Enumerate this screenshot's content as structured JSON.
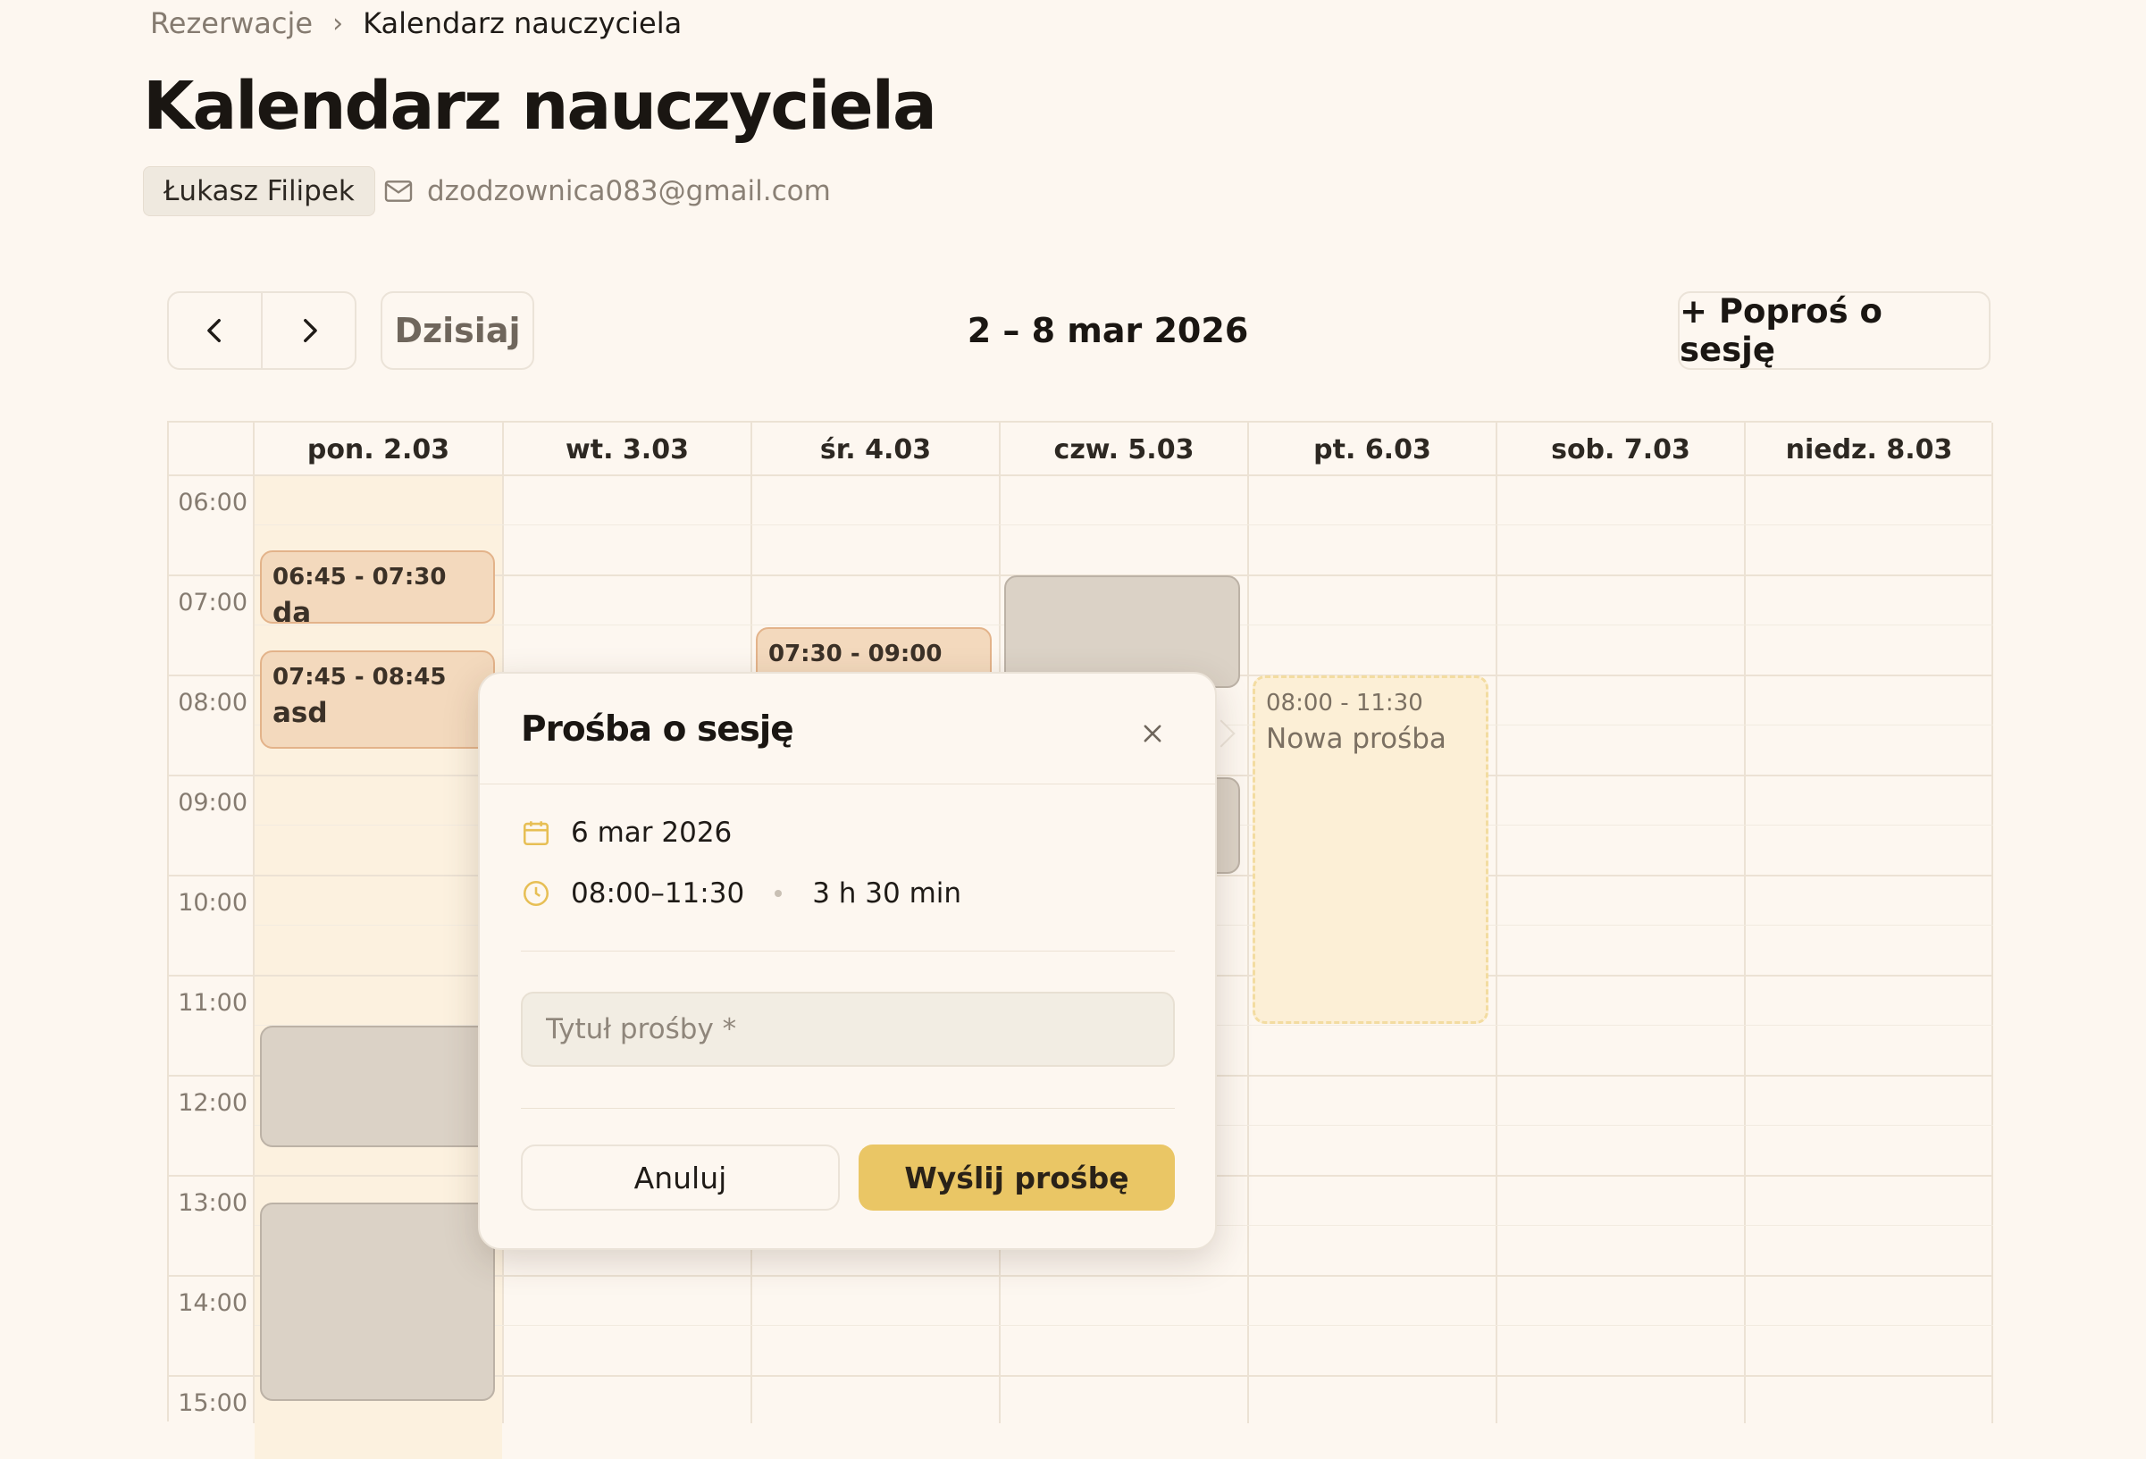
{
  "breadcrumb": {
    "parent": "Rezerwacje",
    "separator": "›",
    "current": "Kalendarz nauczyciela"
  },
  "page_title": "Kalendarz nauczyciela",
  "teacher": {
    "name": "Łukasz Filipek",
    "email": "dzodzownica083@gmail.com"
  },
  "toolbar": {
    "today_label": "Dzisiaj",
    "range_label": "2 – 8 mar 2026",
    "request_label": "+ Poproś o sesję"
  },
  "days": [
    "pon. 2.03",
    "wt. 3.03",
    "śr. 4.03",
    "czw. 5.03",
    "pt. 6.03",
    "sob. 7.03",
    "niedz. 8.03"
  ],
  "hours": [
    "06:00",
    "07:00",
    "08:00",
    "09:00",
    "10:00",
    "11:00",
    "12:00",
    "13:00",
    "14:00",
    "15:00"
  ],
  "events": {
    "e1": {
      "time": "06:45 - 07:30",
      "title": "da"
    },
    "e2": {
      "time": "07:45 - 08:45",
      "title": "asd"
    },
    "e3": {
      "time": "07:30 - 09:00",
      "title": ""
    },
    "pending": {
      "time": "08:00 - 11:30",
      "title": "Nowa prośba"
    }
  },
  "popover": {
    "title": "Prośba o sesję",
    "date": "6 mar 2026",
    "time_range": "08:00–11:30",
    "duration": "3 h 30 min",
    "title_placeholder": "Tytuł prośby *",
    "title_value": "",
    "cancel_label": "Anuluj",
    "send_label": "Wyślij prośbę"
  },
  "colors": {
    "background": "#fdf7f0",
    "accent": "#eac665",
    "own_event": "#f3d9bd",
    "busy_event": "#dbd2c6",
    "today_column": "#fcf1df"
  }
}
